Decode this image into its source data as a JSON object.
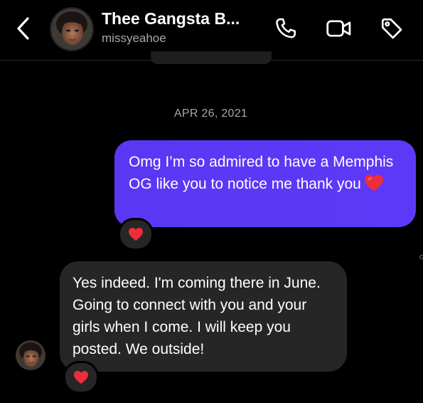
{
  "header": {
    "title": "Thee Gangsta B...",
    "username": "missyeahoe",
    "icons": [
      "chevron-left-icon",
      "phone-icon",
      "video-camera-icon",
      "tag-icon"
    ]
  },
  "conversation": {
    "date": "APR 26, 2021",
    "messages": [
      {
        "direction": "outgoing",
        "text": "Omg I’m so admired to have a Memphis OG like you to notice me thank you",
        "inline_emoji": "heart",
        "reaction": "heart"
      },
      {
        "direction": "incoming",
        "text": "Yes indeed. I'm coming there in June. Going to connect with you and your girls when I come. I will keep you posted. We outside!",
        "reaction": "heart"
      }
    ]
  },
  "colors": {
    "background": "#000000",
    "outgoing_bubble": "#5b38f6",
    "incoming_bubble": "#262626",
    "secondary_text": "#a8a8a8",
    "heart": "#ee2d3a"
  }
}
